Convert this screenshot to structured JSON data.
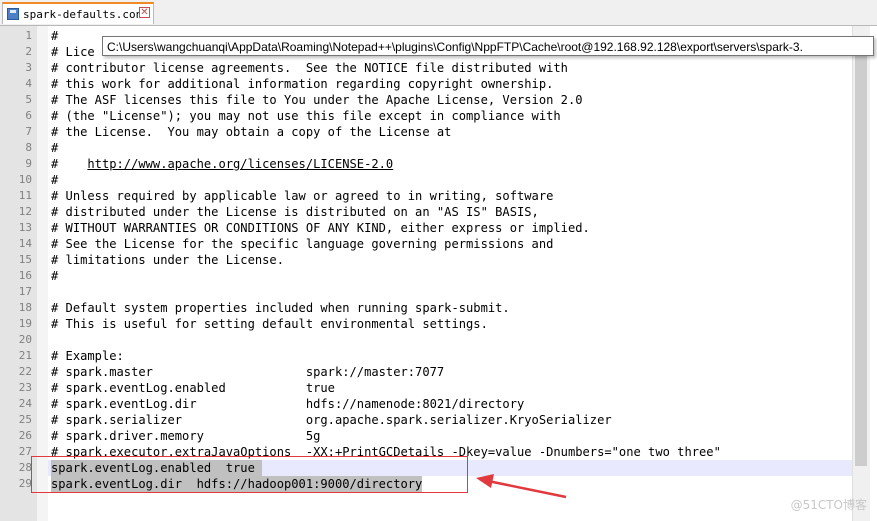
{
  "tab": {
    "filename": "spark-defaults.conf",
    "close_glyph": "✕"
  },
  "tooltip": {
    "path": "C:\\Users\\wangchuanqi\\AppData\\Roaming\\Notepad++\\plugins\\Config\\NppFTP\\Cache\\root@192.168.92.128\\export\\servers\\spark-3."
  },
  "editor": {
    "lines": [
      {
        "n": "1",
        "text": "#"
      },
      {
        "n": "2",
        "text": "# Lice"
      },
      {
        "n": "3",
        "text": "# contributor license agreements.  See the NOTICE file distributed with"
      },
      {
        "n": "4",
        "text": "# this work for additional information regarding copyright ownership."
      },
      {
        "n": "5",
        "text": "# The ASF licenses this file to You under the Apache License, Version 2.0"
      },
      {
        "n": "6",
        "text": "# (the \"License\"); you may not use this file except in compliance with"
      },
      {
        "n": "7",
        "text": "# the License.  You may obtain a copy of the License at"
      },
      {
        "n": "8",
        "text": "#"
      },
      {
        "n": "9",
        "text": "#    ",
        "url": "http://www.apache.org/licenses/LICENSE-2.0"
      },
      {
        "n": "10",
        "text": "#"
      },
      {
        "n": "11",
        "text": "# Unless required by applicable law or agreed to in writing, software"
      },
      {
        "n": "12",
        "text": "# distributed under the License is distributed on an \"AS IS\" BASIS,"
      },
      {
        "n": "13",
        "text": "# WITHOUT WARRANTIES OR CONDITIONS OF ANY KIND, either express or implied."
      },
      {
        "n": "14",
        "text": "# See the License for the specific language governing permissions and"
      },
      {
        "n": "15",
        "text": "# limitations under the License."
      },
      {
        "n": "16",
        "text": "#"
      },
      {
        "n": "17",
        "text": ""
      },
      {
        "n": "18",
        "text": "# Default system properties included when running spark-submit."
      },
      {
        "n": "19",
        "text": "# This is useful for setting default environmental settings."
      },
      {
        "n": "20",
        "text": ""
      },
      {
        "n": "21",
        "text": "# Example:"
      },
      {
        "n": "22",
        "text": "# spark.master                     spark://master:7077"
      },
      {
        "n": "23",
        "text": "# spark.eventLog.enabled           true"
      },
      {
        "n": "24",
        "text": "# spark.eventLog.dir               hdfs://namenode:8021/directory"
      },
      {
        "n": "25",
        "text": "# spark.serializer                 org.apache.spark.serializer.KryoSerializer"
      },
      {
        "n": "26",
        "text": "# spark.driver.memory              5g"
      },
      {
        "n": "27",
        "text": "# spark.executor.extraJavaOptions  -XX:+PrintGCDetails -Dkey=value -Dnumbers=\"one two three\""
      },
      {
        "n": "28",
        "text": "spark.eventLog.enabled  true "
      },
      {
        "n": "29",
        "text": "spark.eventLog.dir  hdfs://hadoop001:9000/directory"
      }
    ]
  },
  "watermark": "@51CTO博客",
  "colors": {
    "annotation": "#e0393e",
    "selection": "#c0c0c0",
    "current_line": "#e8e8ff"
  }
}
